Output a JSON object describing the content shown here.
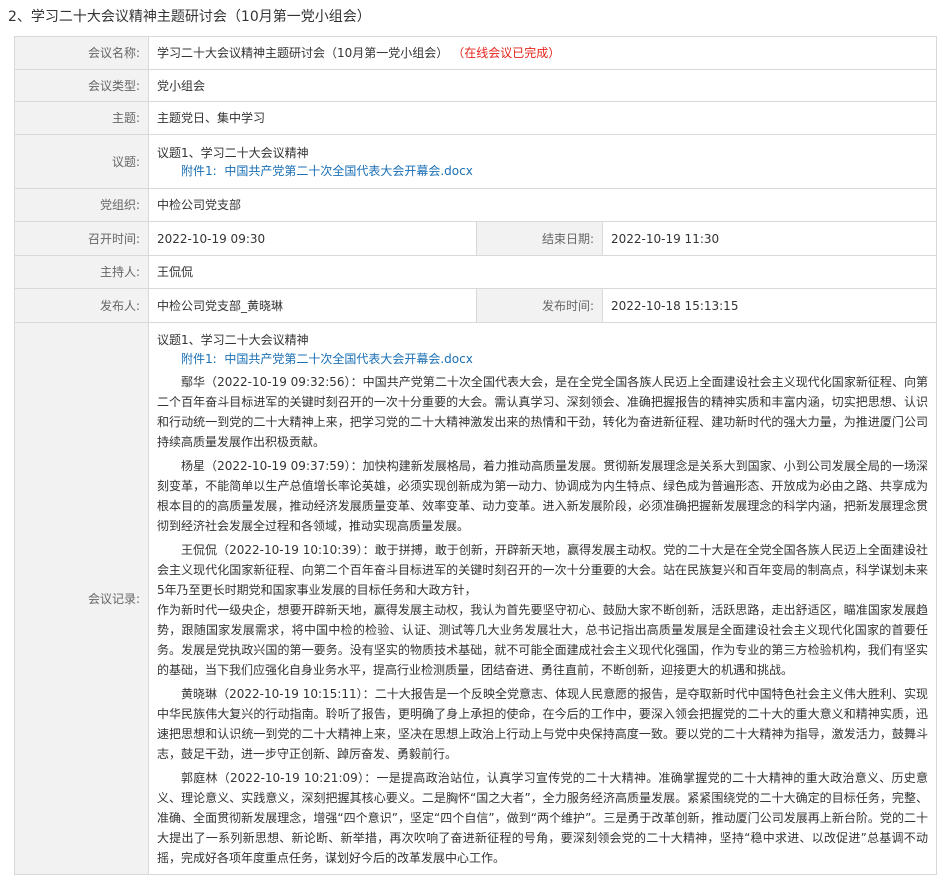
{
  "section": {
    "title": "2、学习二十大会议精神主题研讨会（10月第一党小组会）"
  },
  "labels": {
    "name": "会议名称:",
    "type": "会议类型:",
    "theme": "主题:",
    "agenda": "议题:",
    "org": "党组织:",
    "start": "召开时间:",
    "end": "结束日期:",
    "host": "主持人:",
    "publisher": "发布人:",
    "publish_time": "发布时间:",
    "record": "会议记录:"
  },
  "meeting": {
    "name": "学习二十大会议精神主题研讨会（10月第一党小组会）",
    "status": "（在线会议已完成）",
    "type": "党小组会",
    "theme": "主题党日、集中学习",
    "agenda_title": "议题1、学习二十大会议精神",
    "attachment_prefix": "附件1:",
    "attachment_name": "中国共产党第二十次全国代表大会开幕会.docx",
    "org": "中检公司党支部",
    "start": "2022-10-19 09:30",
    "end": "2022-10-19 11:30",
    "host": "王侃侃",
    "publisher": "中检公司党支部_黄晓琳",
    "publish_time": "2022-10-18 15:13:15"
  },
  "record": {
    "agenda_title": "议题1、学习二十大会议精神",
    "attachment_prefix": "附件1:",
    "attachment_name": "中国共产党第二十次全国代表大会开幕会.docx",
    "entries": [
      {
        "speaker": "鄢华（2022-10-19 09:32:56）：",
        "text": "中国共产党第二十次全国代表大会，是在全党全国各族人民迈上全面建设社会主义现代化国家新征程、向第二个百年奋斗目标进军的关键时刻召开的一次十分重要的大会。需认真学习、深刻领会、准确把握报告的精神实质和丰富内涵，切实把思想、认识和行动统一到党的二十大精神上来，把学习党的二十大精神激发出来的热情和干劲，转化为奋进新征程、建功新时代的强大力量，为推进厦门公司持续高质量发展作出积极贡献。"
      },
      {
        "speaker": "杨星（2022-10-19 09:37:59）：",
        "text": "加快构建新发展格局，着力推动高质量发展。贯彻新发展理念是关系大到国家、小到公司发展全局的一场深刻变革，不能简单以生产总值增长率论英雄，必须实现创新成为第一动力、协调成为内生特点、绿色成为普遍形态、开放成为必由之路、共享成为根本目的的高质量发展，推动经济发展质量变革、效率变革、动力变革。进入新发展阶段，必须准确把握新发展理念的科学内涵，把新发展理念贯彻到经济社会发展全过程和各领域，推动实现高质量发展。"
      },
      {
        "speaker": "王侃侃（2022-10-19 10:10:39）：",
        "text": "敢于拼搏，敢于创新，开辟新天地，赢得发展主动权。党的二十大是在全党全国各族人民迈上全面建设社会主义现代化国家新征程、向第二个百年奋斗目标进军的关键时刻召开的一次十分重要的大会。站在民族复兴和百年变局的制高点，科学谋划未来5年乃至更长时期党和国家事业发展的目标任务和大政方针，",
        "continuation": "作为新时代一级央企，想要开辟新天地，赢得发展主动权，我认为首先要坚守初心、鼓励大家不断创新，活跃思路，走出舒适区，瞄准国家发展趋势，跟随国家发展需求，将中国中检的检验、认证、测试等几大业务发展壮大，总书记指出高质量发展是全面建设社会主义现代化国家的首要任务。发展是党执政兴国的第一要务。没有坚实的物质技术基础，就不可能全面建成社会主义现代化强国，作为专业的第三方检验机构，我们有坚实的基础，当下我们应强化自身业务水平，提高行业检测质量，团结奋进、勇往直前，不断创新，迎接更大的机遇和挑战。"
      },
      {
        "speaker": "黄晓琳（2022-10-19 10:15:11）：",
        "text": "二十大报告是一个反映全党意志、体现人民意愿的报告，是夺取新时代中国特色社会主义伟大胜利、实现中华民族伟大复兴的行动指南。聆听了报告，更明确了身上承担的使命，在今后的工作中，要深入领会把握党的二十大的重大意义和精神实质，迅速把思想和认识统一到党的二十大精神上来，坚决在思想上政治上行动上与党中央保持高度一致。要以党的二十大精神为指导，激发活力，鼓舞斗志，鼓足干劲，进一步守正创新、踔厉奋发、勇毅前行。"
      },
      {
        "speaker": "郭庭林（2022-10-19 10:21:09）：",
        "text": "一是提高政治站位，认真学习宣传党的二十大精神。准确掌握党的二十大精神的重大政治意义、历史意义、理论意义、实践意义，深刻把握其核心要义。二是胸怀“国之大者”，全力服务经济高质量发展。紧紧围绕党的二十大确定的目标任务，完整、准确、全面贯彻新发展理念，增强“四个意识”，坚定“四个自信”，做到“两个维护”。三是勇于改革创新，推动厦门公司发展再上新台阶。党的二十大提出了一系列新思想、新论断、新举措，再次吹响了奋进新征程的号角，要深刻领会党的二十大精神，坚持“稳中求进、以改促进”总基调不动摇，完成好各项年度重点任务，谋划好今后的改革发展中心工作。"
      }
    ]
  }
}
